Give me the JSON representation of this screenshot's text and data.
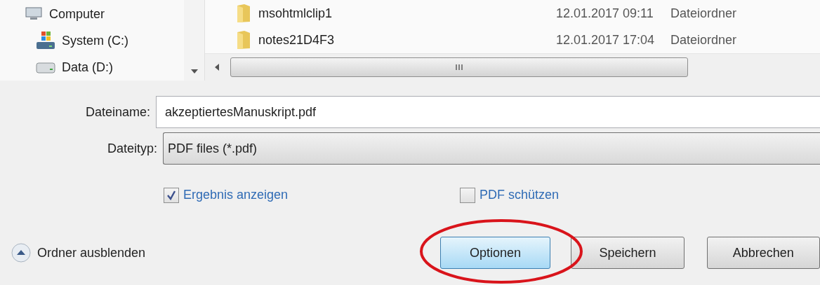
{
  "nav_tree": [
    {
      "label": "Computer",
      "kind": "computer"
    },
    {
      "label": "System (C:)",
      "kind": "system-drive"
    },
    {
      "label": "Data (D:)",
      "kind": "drive"
    }
  ],
  "file_list": {
    "rows": [
      {
        "name": "msohtmlclip1",
        "date": "12.01.2017 09:11",
        "type": "Dateiordner"
      },
      {
        "name": "notes21D4F3",
        "date": "12.01.2017 17:04",
        "type": "Dateiordner"
      }
    ]
  },
  "file_name": {
    "label": "Dateiname:",
    "value": "akzeptiertesManuskript.pdf"
  },
  "file_type": {
    "label": "Dateityp:",
    "value": "PDF files (*.pdf)"
  },
  "options": [
    {
      "label": "Ergebnis anzeigen",
      "checked": true
    },
    {
      "label": "PDF schützen",
      "checked": false
    }
  ],
  "hide_folders": "Ordner ausblenden",
  "buttons": [
    {
      "label": "Optionen",
      "highlighted": true
    },
    {
      "label": "Speichern",
      "highlighted": false
    },
    {
      "label": "Abbrechen",
      "highlighted": false
    }
  ]
}
